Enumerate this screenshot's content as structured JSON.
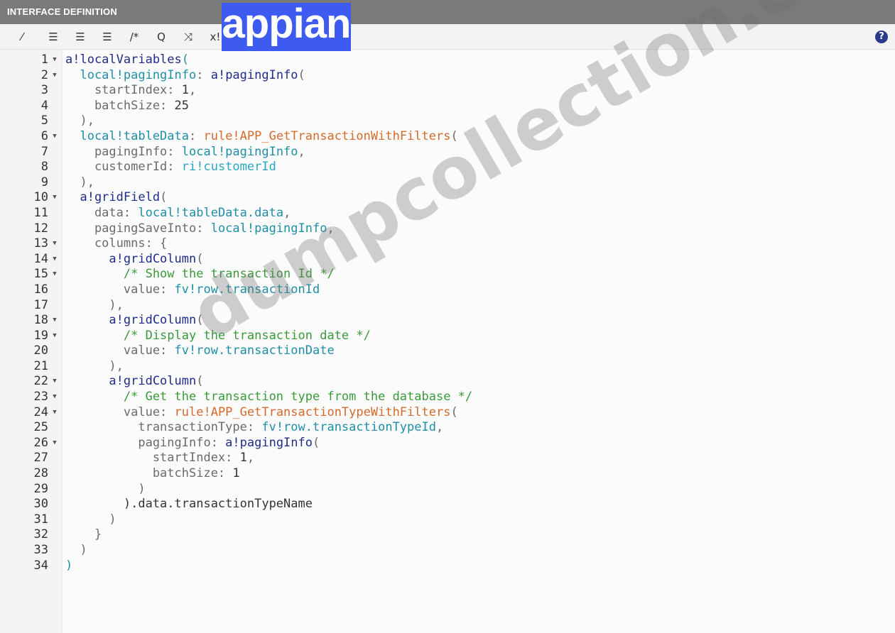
{
  "header": {
    "title": "INTERFACE DEFINITION",
    "logo_text": "appian"
  },
  "toolbar": {
    "tools": [
      {
        "name": "format-icon",
        "glyph": "⁄"
      },
      {
        "name": "outdent-icon",
        "glyph": "☰"
      },
      {
        "name": "indent-icon",
        "glyph": "☰"
      },
      {
        "name": "list-icon",
        "glyph": "☰"
      },
      {
        "name": "comment-icon",
        "glyph": "/*"
      },
      {
        "name": "search-icon",
        "glyph": "Q"
      },
      {
        "name": "shuffle-icon",
        "glyph": "⤨"
      },
      {
        "name": "local-variable-icon",
        "glyph": "x!"
      }
    ],
    "help_glyph": "?"
  },
  "code": {
    "lines": [
      {
        "n": "1",
        "fold": true,
        "t": [
          [
            "fn",
            "a!localVariables"
          ],
          [
            "var",
            "("
          ]
        ]
      },
      {
        "n": "2",
        "fold": true,
        "t": [
          [
            "var",
            "  local!pagingInfo"
          ],
          [
            "kw",
            ": "
          ],
          [
            "fn",
            "a!pagingInfo"
          ],
          [
            "kw",
            "("
          ]
        ]
      },
      {
        "n": "3",
        "fold": false,
        "t": [
          [
            "kw",
            "    startIndex: "
          ],
          [
            "num",
            "1"
          ],
          [
            "kw",
            ","
          ]
        ]
      },
      {
        "n": "4",
        "fold": false,
        "t": [
          [
            "kw",
            "    batchSize: "
          ],
          [
            "num",
            "25"
          ]
        ]
      },
      {
        "n": "5",
        "fold": false,
        "t": [
          [
            "kw",
            "  ),"
          ]
        ]
      },
      {
        "n": "6",
        "fold": true,
        "t": [
          [
            "var",
            "  local!tableData"
          ],
          [
            "kw",
            ": "
          ],
          [
            "rule",
            "rule!APP_GetTransactionWithFilters"
          ],
          [
            "kw",
            "("
          ]
        ]
      },
      {
        "n": "7",
        "fold": false,
        "t": [
          [
            "kw",
            "    pagingInfo: "
          ],
          [
            "var",
            "local!pagingInfo"
          ],
          [
            "kw",
            ","
          ]
        ]
      },
      {
        "n": "8",
        "fold": false,
        "t": [
          [
            "kw",
            "    customerId: "
          ],
          [
            "ri",
            "ri!customerId"
          ]
        ]
      },
      {
        "n": "9",
        "fold": false,
        "t": [
          [
            "kw",
            "  ),"
          ]
        ]
      },
      {
        "n": "10",
        "fold": true,
        "t": [
          [
            "fn",
            "  a!gridField"
          ],
          [
            "kw",
            "("
          ]
        ]
      },
      {
        "n": "11",
        "fold": false,
        "t": [
          [
            "kw",
            "    data: "
          ],
          [
            "var",
            "local!tableData.data"
          ],
          [
            "kw",
            ","
          ]
        ]
      },
      {
        "n": "12",
        "fold": false,
        "t": [
          [
            "kw",
            "    pagingSaveInto: "
          ],
          [
            "var",
            "local!pagingInfo"
          ],
          [
            "kw",
            ","
          ]
        ]
      },
      {
        "n": "13",
        "fold": true,
        "t": [
          [
            "kw",
            "    columns: {"
          ]
        ]
      },
      {
        "n": "14",
        "fold": true,
        "t": [
          [
            "fn",
            "      a!gridColumn"
          ],
          [
            "kw",
            "("
          ]
        ]
      },
      {
        "n": "15",
        "fold": true,
        "t": [
          [
            "cmt",
            "        /* Show the transaction Id */"
          ]
        ]
      },
      {
        "n": "16",
        "fold": false,
        "t": [
          [
            "kw",
            "        value: "
          ],
          [
            "var",
            "fv!row.transactionId"
          ]
        ]
      },
      {
        "n": "17",
        "fold": false,
        "t": [
          [
            "kw",
            "      ),"
          ]
        ]
      },
      {
        "n": "18",
        "fold": true,
        "t": [
          [
            "fn",
            "      a!gridColumn"
          ],
          [
            "kw",
            "("
          ]
        ]
      },
      {
        "n": "19",
        "fold": true,
        "t": [
          [
            "cmt",
            "        /* Display the transaction date */"
          ]
        ]
      },
      {
        "n": "20",
        "fold": false,
        "t": [
          [
            "kw",
            "        value: "
          ],
          [
            "var",
            "fv!row.transactionDate"
          ]
        ]
      },
      {
        "n": "21",
        "fold": false,
        "t": [
          [
            "kw",
            "      ),"
          ]
        ]
      },
      {
        "n": "22",
        "fold": true,
        "t": [
          [
            "fn",
            "      a!gridColumn"
          ],
          [
            "kw",
            "("
          ]
        ]
      },
      {
        "n": "23",
        "fold": true,
        "t": [
          [
            "cmt",
            "        /* Get the transaction type from the database */"
          ]
        ]
      },
      {
        "n": "24",
        "fold": true,
        "t": [
          [
            "kw",
            "        value: "
          ],
          [
            "rule",
            "rule!APP_GetTransactionTypeWithFilters"
          ],
          [
            "kw",
            "("
          ]
        ]
      },
      {
        "n": "25",
        "fold": false,
        "t": [
          [
            "kw",
            "          transactionType: "
          ],
          [
            "var",
            "fv!row.transactionTypeId"
          ],
          [
            "kw",
            ","
          ]
        ]
      },
      {
        "n": "26",
        "fold": true,
        "t": [
          [
            "kw",
            "          pagingInfo: "
          ],
          [
            "fn",
            "a!pagingInfo"
          ],
          [
            "kw",
            "("
          ]
        ]
      },
      {
        "n": "27",
        "fold": false,
        "t": [
          [
            "kw",
            "            startIndex: "
          ],
          [
            "num",
            "1"
          ],
          [
            "kw",
            ","
          ]
        ]
      },
      {
        "n": "28",
        "fold": false,
        "t": [
          [
            "kw",
            "            batchSize: "
          ],
          [
            "num",
            "1"
          ]
        ]
      },
      {
        "n": "29",
        "fold": false,
        "t": [
          [
            "kw",
            "          )"
          ]
        ]
      },
      {
        "n": "30",
        "fold": false,
        "t": [
          [
            "num",
            "        ).data.transactionTypeName"
          ]
        ]
      },
      {
        "n": "31",
        "fold": false,
        "t": [
          [
            "kw",
            "      )"
          ]
        ]
      },
      {
        "n": "32",
        "fold": false,
        "t": [
          [
            "kw",
            "    }"
          ]
        ]
      },
      {
        "n": "33",
        "fold": false,
        "t": [
          [
            "kw",
            "  )"
          ]
        ]
      },
      {
        "n": "34",
        "fold": false,
        "t": [
          [
            "var",
            ")"
          ]
        ]
      }
    ]
  },
  "watermark": "dumpcollection.com"
}
